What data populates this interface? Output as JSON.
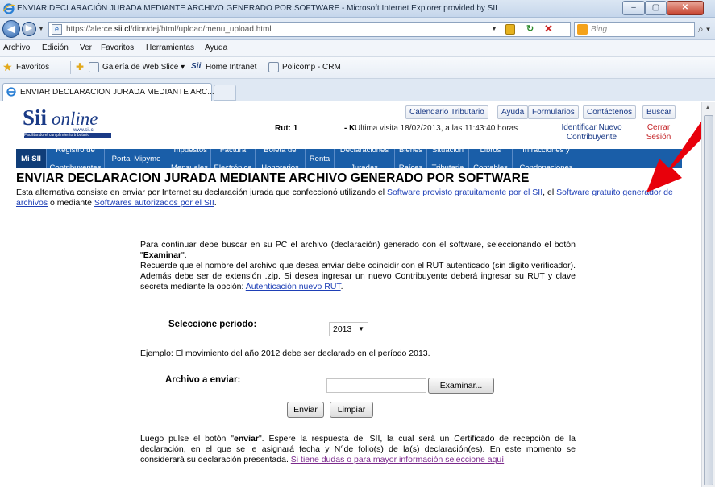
{
  "window": {
    "title": "ENVIAR DECLARACIÓN JURADA MEDIANTE ARCHIVO GENERADO POR SOFTWARE - Microsoft Internet Explorer provided by SII",
    "min_label": "–",
    "max_label": "▢",
    "close_label": "✕"
  },
  "address": {
    "url_prefix": "https://alerce.",
    "url_domain": "sii.cl",
    "url_rest": "/dior/dej/html/upload/menu_upload.html",
    "search_placeholder": "Bing"
  },
  "menu": [
    "Archivo",
    "Edición",
    "Ver",
    "Favoritos",
    "Herramientas",
    "Ayuda"
  ],
  "favorites": {
    "label": "Favoritos",
    "items": [
      "Galería de Web Slice ▾",
      "Home Intranet",
      "Policomp - CRM"
    ],
    "sii_mini": "Sii"
  },
  "tab": {
    "title": "ENVIAR DECLARACION JURADA MEDIANTE ARC..."
  },
  "site": {
    "logo_big": "Sii",
    "logo_online": "online",
    "logo_domain": "www.sii.cl",
    "logo_tagline": "Facilitando el cumplimiento tributario",
    "toplinks": [
      "Calendario Tributario",
      "Ayuda",
      "Formularios",
      "Contáctenos",
      "Buscar"
    ],
    "rut_label": "Rut: 1",
    "rut_dv": "- K",
    "ultima_visita": "Ultima visita 18/02/2013, a las 11:43:40 horas",
    "identificar_1": "Identificar Nuevo",
    "identificar_2": "Contribuyente",
    "cerrar_1": "Cerrar",
    "cerrar_2": "Sesión",
    "nav": [
      {
        "l1": "Mi SII",
        "l2": ""
      },
      {
        "l1": "Registro de",
        "l2": "Contribuyentes"
      },
      {
        "l1": "Portal Mipyme",
        "l2": ""
      },
      {
        "l1": "Impuestos",
        "l2": "Mensuales"
      },
      {
        "l1": "Factura",
        "l2": "Electrónica"
      },
      {
        "l1": "Boleta de",
        "l2": "Honorarios"
      },
      {
        "l1": "Renta",
        "l2": ""
      },
      {
        "l1": "Declaraciones",
        "l2": "Juradas"
      },
      {
        "l1": "Bienes",
        "l2": "Raíces"
      },
      {
        "l1": "Situación",
        "l2": "Tributaria"
      },
      {
        "l1": "Libros",
        "l2": "Contables"
      },
      {
        "l1": "Infracciones y",
        "l2": "Condonaciones"
      }
    ]
  },
  "content": {
    "heading": "ENVIAR DECLARACION JURADA MEDIANTE ARCHIVO GENERADO POR SOFTWARE",
    "intro_a": "Esta alternativa consiste en enviar por Internet su declaración jurada que confeccionó utilizando el ",
    "intro_link1": "Software provisto gratuitamente por el SII",
    "intro_b": ", el ",
    "intro_link2": "Software gratuito generador de archivos",
    "intro_c": " o mediante ",
    "intro_link3": "Softwares autorizados por el SII",
    "intro_d": ".",
    "p1_a": "Para continuar debe buscar en su PC el archivo (declaración) generado con el software, seleccionando el botón \"",
    "p1_b": "Examinar",
    "p1_c": "\".",
    "p2_a": "Recuerde que el nombre del archivo que desea enviar debe coincidir con el RUT autenticado (sin dígito verificador). Además debe ser de extensión .zip. Si desea ingresar un nuevo Contribuyente deberá ingresar su RUT y clave secreta mediante la opción: ",
    "p2_link": "Autenticación nuevo RUT",
    "p2_b": ".",
    "periodo_label": "Seleccione periodo:",
    "periodo_value": "2013",
    "ejemplo": "Ejemplo: El movimiento del año 2012 debe ser declarado en el período 2013.",
    "archivo_label": "Archivo a enviar:",
    "examinar_btn": "Examinar...",
    "enviar_btn": "Enviar",
    "limpiar_btn": "Limpiar",
    "p3_a": "Luego pulse el botón \"",
    "p3_b": "enviar",
    "p3_c": "\". Espere la respuesta del SII, la cual será un Certificado de recepción de la declaración, en el que se le asignará fecha y N°de folio(s) de la(s) declaración(es). En este momento se considerará su declaración presentada. ",
    "p3_link": "Si tiene dudas o para mayor información seleccione aquí"
  },
  "colors": {
    "nav_blue": "#1a5ea8",
    "link_blue": "#1e3fb6",
    "annotation_red": "#e8000b"
  }
}
